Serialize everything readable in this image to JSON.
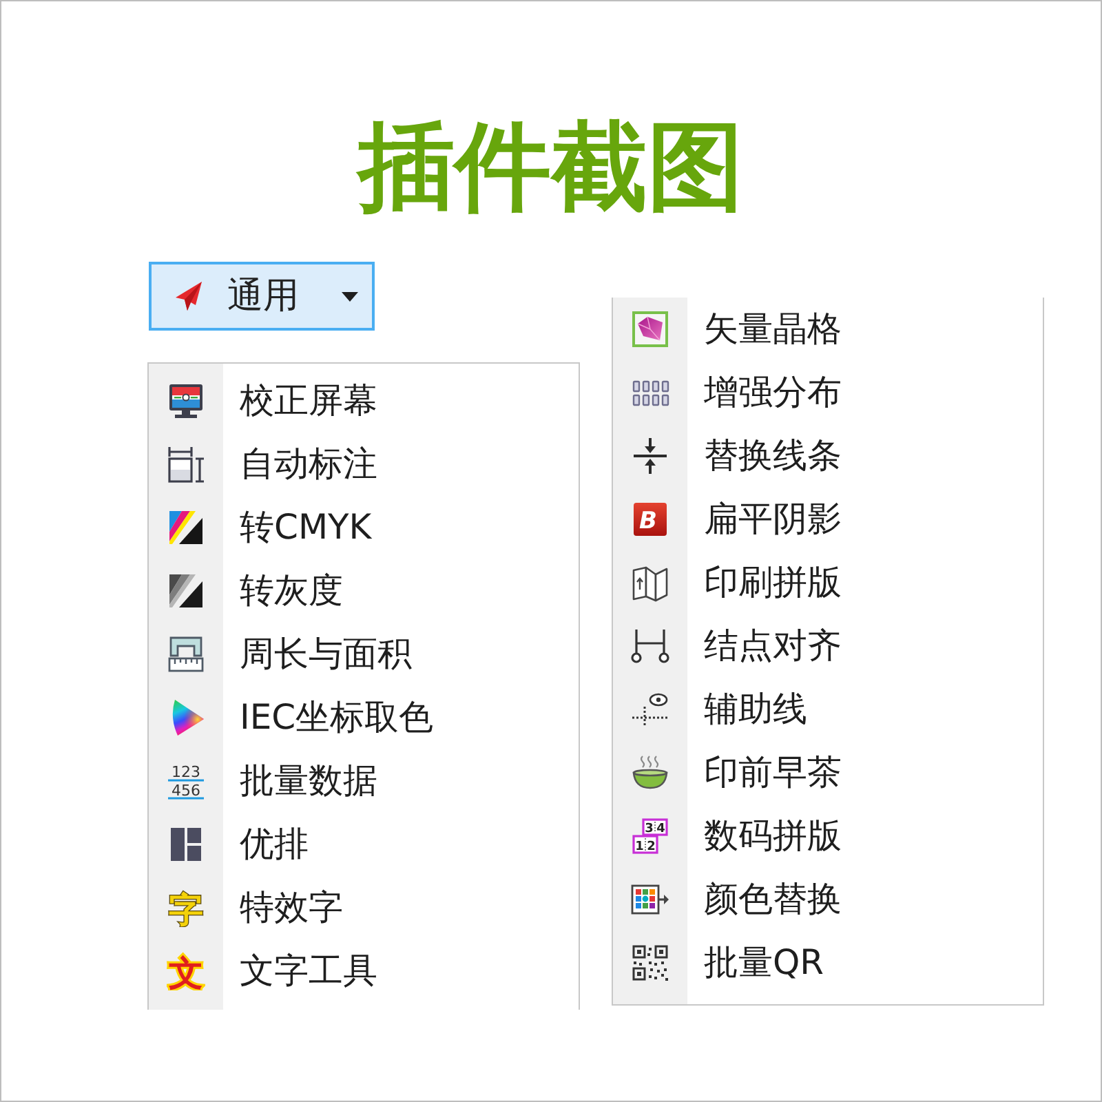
{
  "title": "插件截图",
  "dropdown": {
    "label": "通用"
  },
  "menus": [
    {
      "items": [
        {
          "label": "校正屏幕"
        },
        {
          "label": "自动标注"
        },
        {
          "label": "转CMYK"
        },
        {
          "label": "转灰度"
        },
        {
          "label": "周长与面积"
        },
        {
          "label": "IEC坐标取色"
        },
        {
          "label": "批量数据",
          "icon_text": [
            "123",
            "456"
          ]
        },
        {
          "label": "优排"
        },
        {
          "label": "特效字",
          "icon_text": [
            "字"
          ]
        },
        {
          "label": "文字工具",
          "icon_text": [
            "文"
          ]
        }
      ]
    },
    {
      "items": [
        {
          "label": "矢量晶格"
        },
        {
          "label": "增强分布"
        },
        {
          "label": "替换线条"
        },
        {
          "label": "扁平阴影",
          "icon_text": [
            "B"
          ]
        },
        {
          "label": "印刷拼版"
        },
        {
          "label": "结点对齐"
        },
        {
          "label": "辅助线"
        },
        {
          "label": "印前早茶"
        },
        {
          "label": "数码拼版",
          "icon_text": [
            "3",
            "4",
            "1",
            "2"
          ]
        },
        {
          "label": "颜色替换"
        },
        {
          "label": "批量QR"
        }
      ]
    }
  ]
}
